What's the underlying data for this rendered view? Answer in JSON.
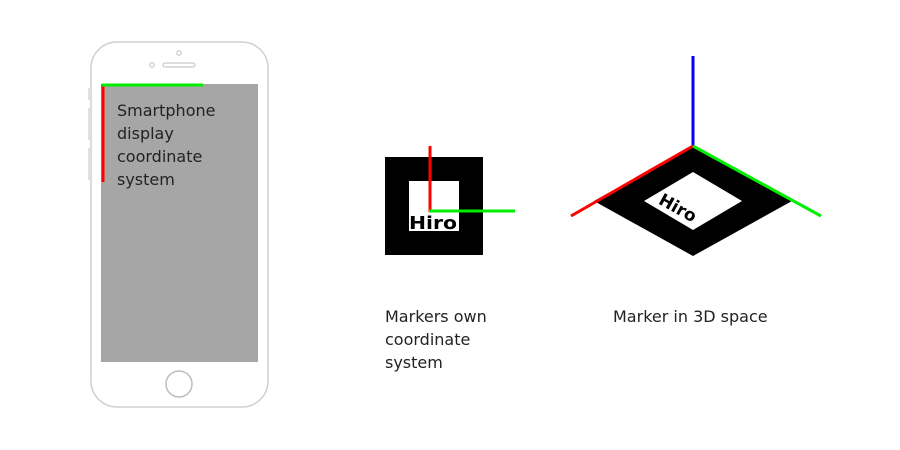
{
  "colors": {
    "x_axis": "#ff0000",
    "y_axis": "#00ee00",
    "z_axis": "#0000ff",
    "marker": "#000000",
    "screen": "#a6a6a6",
    "phone_outline": "#cfcfcf"
  },
  "phone": {
    "label_lines": [
      "Smartphone",
      "display",
      "coordinate",
      "system"
    ]
  },
  "marker_2d": {
    "pattern_text": "Hiro",
    "label_lines": [
      "Markers own",
      "coordinate",
      "system"
    ]
  },
  "marker_3d": {
    "pattern_text": "Hiro",
    "label_lines": [
      "Marker in 3D space"
    ]
  }
}
